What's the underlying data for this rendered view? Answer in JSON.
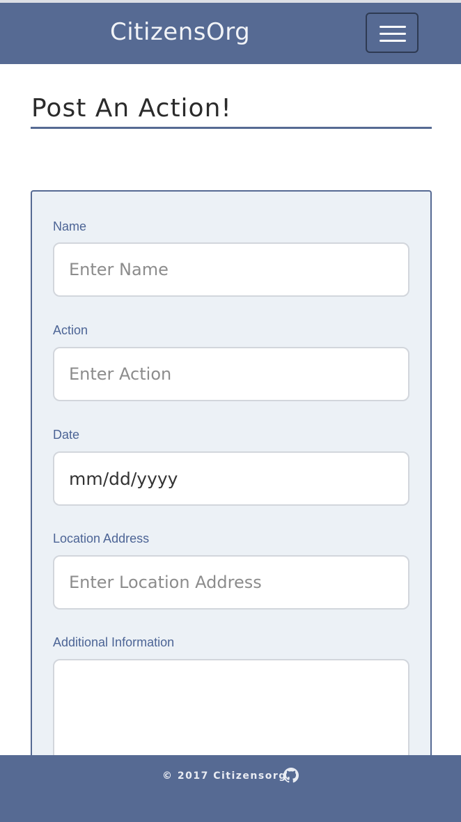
{
  "navbar": {
    "brand": "CitizensOrg",
    "menu_icon": "hamburger-menu-icon"
  },
  "page": {
    "title": "Post An Action!"
  },
  "form": {
    "name": {
      "label": "Name",
      "placeholder": "Enter Name"
    },
    "action": {
      "label": "Action",
      "placeholder": "Enter Action"
    },
    "date": {
      "label": "Date",
      "value": "mm/dd/yyyy"
    },
    "location": {
      "label": "Location Address",
      "placeholder": "Enter Location Address"
    },
    "additional_info": {
      "label": "Additional Information",
      "value": ""
    }
  },
  "footer": {
    "copyright": "© 2017 Citizensorg.",
    "github_icon": "github-icon"
  },
  "colors": {
    "brand_blue": "#566a93",
    "label_blue": "#4c6495",
    "form_background": "#ecf1f6"
  }
}
